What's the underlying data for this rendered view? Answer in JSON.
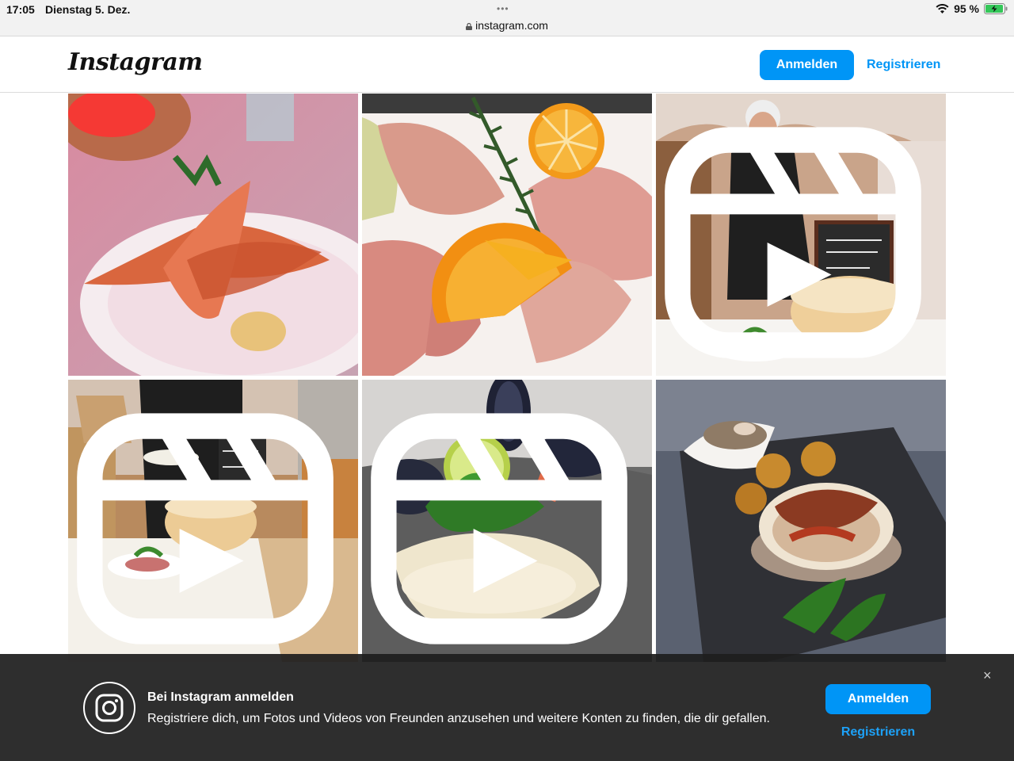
{
  "status_bar": {
    "time": "17:05",
    "date": "Dienstag 5. Dez.",
    "dots": "•••",
    "url": "instagram.com",
    "battery": "95 %"
  },
  "header": {
    "logo": "Instagram",
    "login_label": "Anmelden",
    "register_label": "Registrieren",
    "accent_color": "#0095f6"
  },
  "grid": {
    "posts": [
      {
        "subject": "grilled prawns on white plate",
        "is_reel": false
      },
      {
        "subject": "prosciutto with melon and orange slices",
        "is_reel": false
      },
      {
        "subject": "chef at cheese wheel in restaurant",
        "is_reel": true
      },
      {
        "subject": "waiter serving pasta from cheese wheel",
        "is_reel": true
      },
      {
        "subject": "mussels with lime and parsley",
        "is_reel": true
      },
      {
        "subject": "ravioli with croquettes on slate",
        "is_reel": false
      }
    ]
  },
  "banner": {
    "title": "Bei Instagram anmelden",
    "text": "Registriere dich, um Fotos und Videos von Freunden anzusehen und weitere Konten zu finden, die dir gefallen.",
    "login_label": "Anmelden",
    "register_label": "Registrieren",
    "close_glyph": "×"
  }
}
